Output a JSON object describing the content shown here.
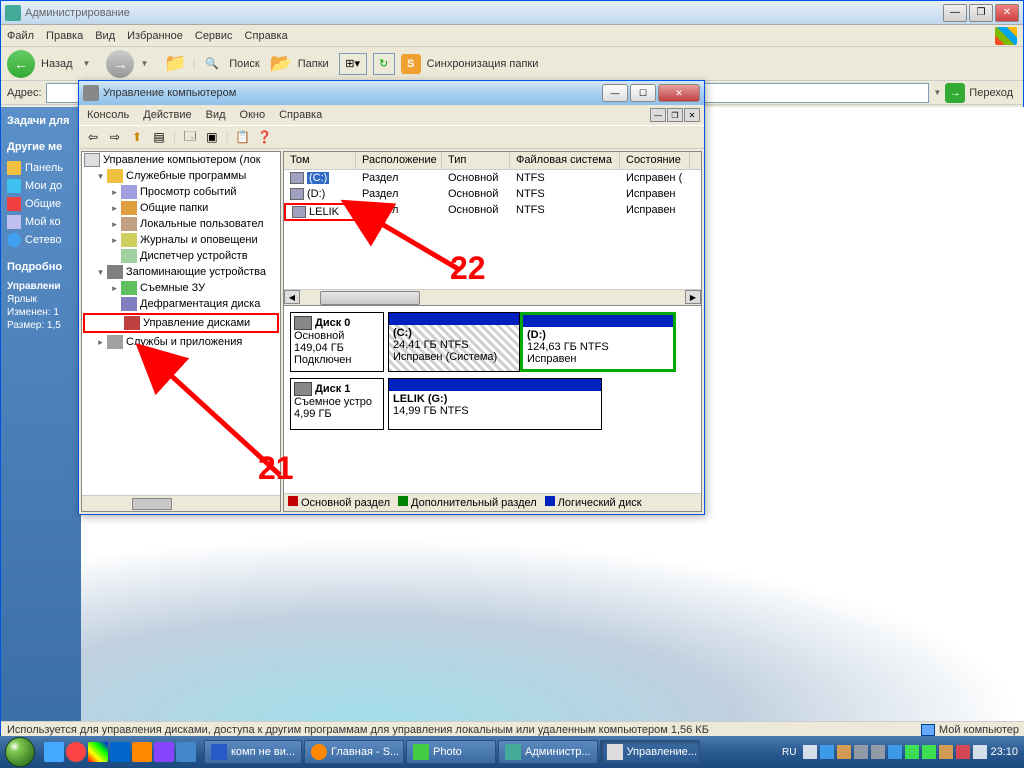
{
  "explorer": {
    "title": "Администрирование",
    "menu": [
      "Файл",
      "Правка",
      "Вид",
      "Избранное",
      "Сервис",
      "Справка"
    ],
    "nav_back": "Назад",
    "search": "Поиск",
    "folders": "Папки",
    "sync": "Синхронизация папки",
    "address_label": "Адрес:",
    "go": "Переход"
  },
  "sidebar": {
    "tasks_header": "Задачи для",
    "other_header": "Другие ме",
    "items": [
      "Панель",
      "Мои до",
      "Общие",
      "Мой ко",
      "Сетево"
    ],
    "details_header": "Подробно",
    "detail_title": "Управлени",
    "detail_sub": "Ярлык",
    "detail_mod": "Изменен: 1",
    "detail_size": "Размер: 1,5"
  },
  "mgmt": {
    "title": "Управление компьютером",
    "menu": [
      "Консоль",
      "Действие",
      "Вид",
      "Окно",
      "Справка"
    ],
    "tree": {
      "root": "Управление компьютером (лок",
      "utilities": "Служебные программы",
      "events": "Просмотр событий",
      "shared": "Общие папки",
      "users": "Локальные пользовател",
      "logs": "Журналы и оповещени",
      "devices": "Диспетчер устройств",
      "storage": "Запоминающие устройства",
      "removable": "Съемные ЗУ",
      "defrag": "Дефрагментация диска",
      "diskmgmt": "Управление дисками",
      "services": "Службы и приложения"
    },
    "vol_headers": [
      "Том",
      "Расположение",
      "Тип",
      "Файловая система",
      "Состояние"
    ],
    "vol_rows": [
      {
        "name": "(C:)",
        "layout": "Раздел",
        "type": "Основной",
        "fs": "NTFS",
        "status": "Исправен ("
      },
      {
        "name": "(D:)",
        "layout": "Раздел",
        "type": "Основной",
        "fs": "NTFS",
        "status": "Исправен"
      },
      {
        "name": "LELIK",
        "layout": "Раздел",
        "type": "Основной",
        "fs": "NTFS",
        "status": "Исправен"
      }
    ],
    "disk0": {
      "title": "Диск 0",
      "type": "Основной",
      "size": "149,04 ГБ",
      "status": "Подключен"
    },
    "disk0_c": {
      "name": "(C:)",
      "info": "24,41 ГБ NTFS",
      "status": "Исправен (Система)"
    },
    "disk0_d": {
      "name": "(D:)",
      "info": "124,63 ГБ NTFS",
      "status": "Исправен"
    },
    "disk1": {
      "title": "Диск 1",
      "type": "Съемное устро",
      "size": "4,99 ГБ"
    },
    "disk1_g": {
      "name": "LELIK  (G:)",
      "info": "14,99 ГБ NTFS"
    },
    "legend": [
      "Основной раздел",
      "Дополнительный раздел",
      "Логический диск"
    ]
  },
  "annotations": {
    "a21": "21",
    "a22": "22"
  },
  "statusbar": {
    "text": "Используется для управления дисками, доступа к другим программам для управления локальным или удаленным компьютером 1,56 КБ",
    "right": "Мой компьютер"
  },
  "taskbar": {
    "tasks": [
      "комп не ви...",
      "Главная - S...",
      "Photo",
      "Администр...",
      "Управление..."
    ],
    "lang": "RU",
    "time": "23:10"
  }
}
